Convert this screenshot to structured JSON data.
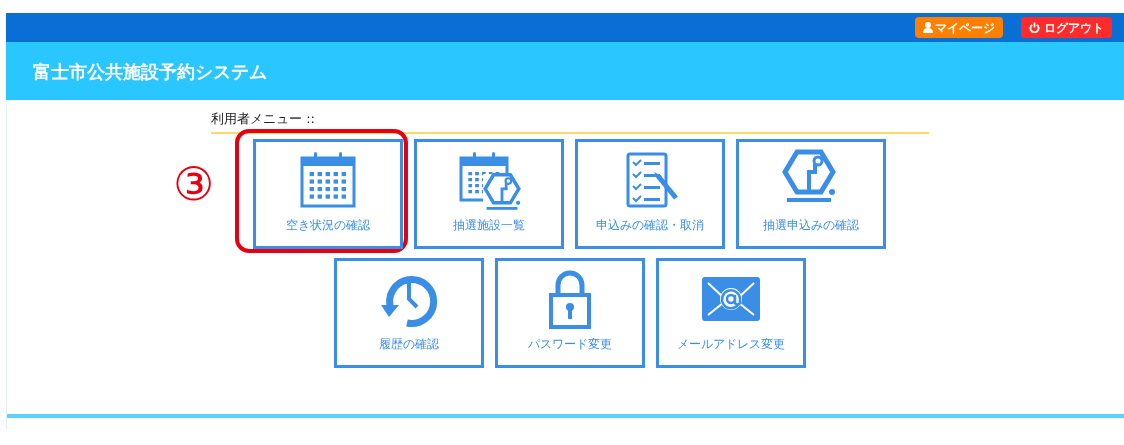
{
  "header": {
    "buttons": [
      {
        "label": "マイページ",
        "kind": "mypage"
      },
      {
        "label": "ログアウト",
        "kind": "logout"
      }
    ],
    "title": "富士市公共施設予約システム"
  },
  "menu": {
    "heading": "利用者メニュー ::",
    "rows": [
      [
        {
          "label": "空き状況の確認",
          "kind": "calendar",
          "highlighted": true,
          "callout": "③"
        },
        {
          "label": "抽選施設一覧",
          "kind": "calendar-lottery",
          "highlighted": false
        },
        {
          "label": "申込みの確認・取消",
          "kind": "checklist",
          "highlighted": false
        },
        {
          "label": "抽選申込みの確認",
          "kind": "lottery",
          "highlighted": false
        }
      ],
      [
        {
          "label": "履歴の確認",
          "kind": "history",
          "highlighted": false
        },
        {
          "label": "パスワード変更",
          "kind": "lock",
          "highlighted": false
        },
        {
          "label": "メールアドレス変更",
          "kind": "mail",
          "highlighted": false
        }
      ]
    ]
  }
}
